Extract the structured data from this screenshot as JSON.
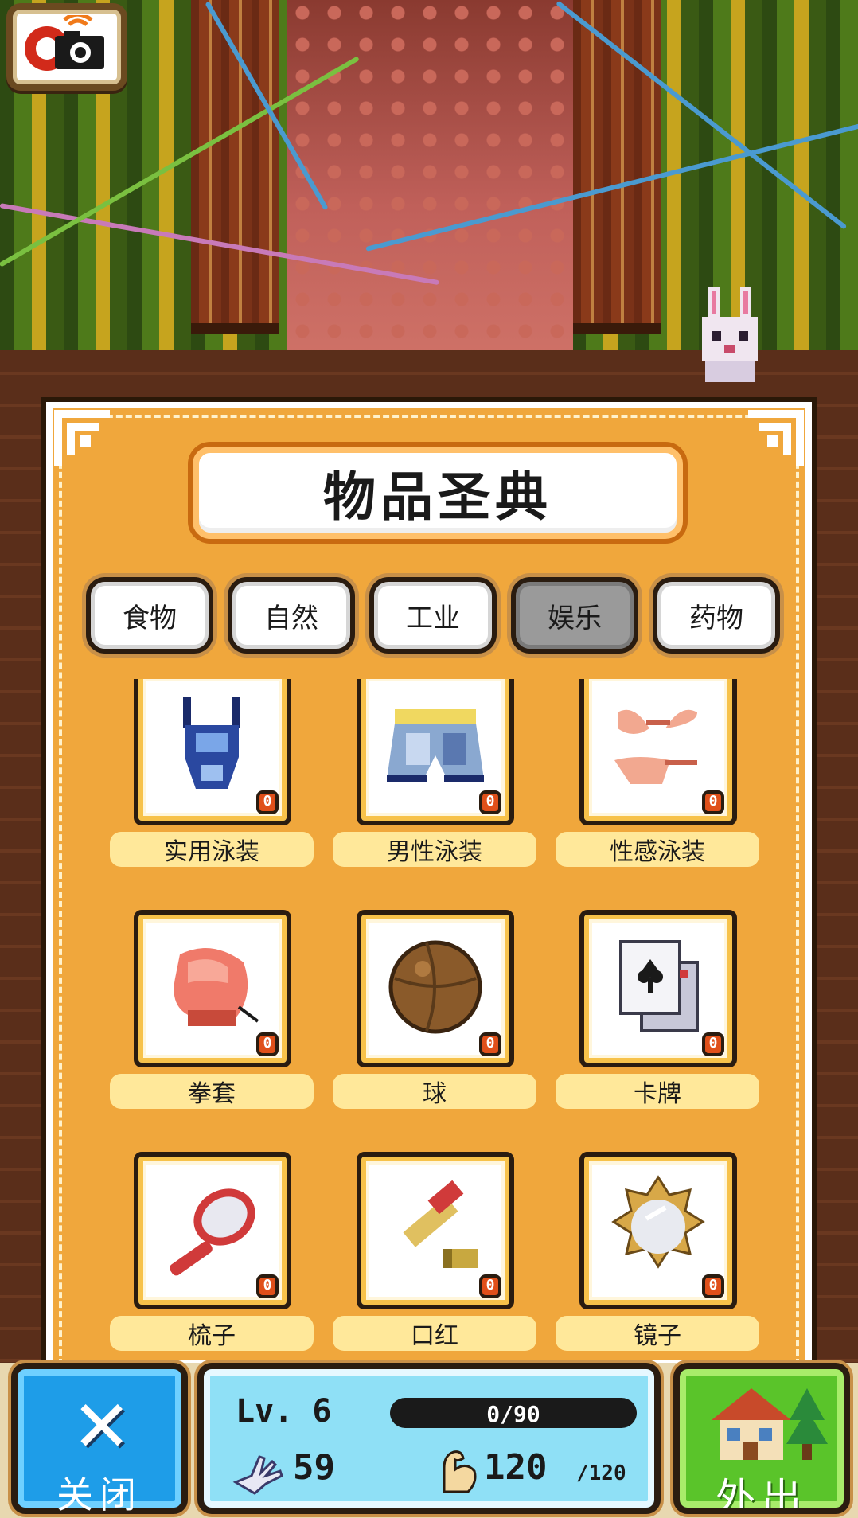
{
  "header": {
    "camera_icon": "camera-icon"
  },
  "panel": {
    "title": "物品圣典",
    "tabs": [
      {
        "label": "食物",
        "active": false
      },
      {
        "label": "自然",
        "active": false
      },
      {
        "label": "工业",
        "active": false
      },
      {
        "label": "娱乐",
        "active": true
      },
      {
        "label": "药物",
        "active": false
      }
    ],
    "items": [
      {
        "label": "实用泳装",
        "count": "0",
        "icon": "swimsuit-icon"
      },
      {
        "label": "男性泳装",
        "count": "0",
        "icon": "swim-trunks-icon"
      },
      {
        "label": "性感泳装",
        "count": "0",
        "icon": "bikini-icon"
      },
      {
        "label": "拳套",
        "count": "0",
        "icon": "boxing-glove-icon"
      },
      {
        "label": "球",
        "count": "0",
        "icon": "ball-icon"
      },
      {
        "label": "卡牌",
        "count": "0",
        "icon": "playing-cards-icon"
      },
      {
        "label": "梳子",
        "count": "0",
        "icon": "hairbrush-icon"
      },
      {
        "label": "口红",
        "count": "0",
        "icon": "lipstick-icon"
      },
      {
        "label": "镜子",
        "count": "0",
        "icon": "mirror-icon"
      }
    ]
  },
  "footer": {
    "close_label": "关闭",
    "close_icon": "close-x-icon",
    "level": "Lv. 6",
    "xp_text": "0/90",
    "xp_fraction": 0,
    "hand_value": "59",
    "strength_value": "120",
    "strength_max": "/120",
    "out_label": "外出",
    "out_icon": "town-house-icon"
  },
  "colors": {
    "panel": "#f0a73c",
    "close_button": "#1e9de8",
    "out_button": "#5ac42a",
    "stats_box": "#8fe0f6",
    "count_badge": "#e0501a"
  }
}
